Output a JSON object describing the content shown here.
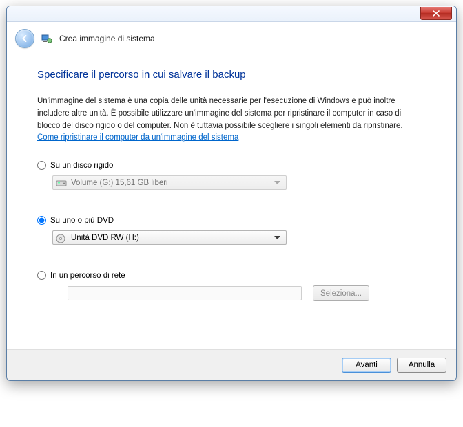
{
  "window": {
    "title": "Crea immagine di sistema"
  },
  "heading": "Specificare il percorso in cui salvare il backup",
  "description": "Un'immagine del sistema è una copia delle unità necessarie per l'esecuzione di Windows e può inoltre includere altre unità. È possibile utilizzare un'immagine del sistema per ripristinare il computer in caso di blocco del disco rigido o del computer. Non è tuttavia possibile scegliere i singoli elementi da ripristinare. ",
  "help_link": "Come ripristinare il computer da un'immagine del sistema",
  "options": {
    "hdd": {
      "label": "Su un disco rigido",
      "value": "Volume (G:)  15,61 GB liberi"
    },
    "dvd": {
      "label": "Su uno o più DVD",
      "value": "Unità DVD RW (H:)"
    },
    "network": {
      "label": "In un percorso di rete",
      "browse": "Seleziona..."
    }
  },
  "buttons": {
    "next": "Avanti",
    "cancel": "Annulla"
  }
}
